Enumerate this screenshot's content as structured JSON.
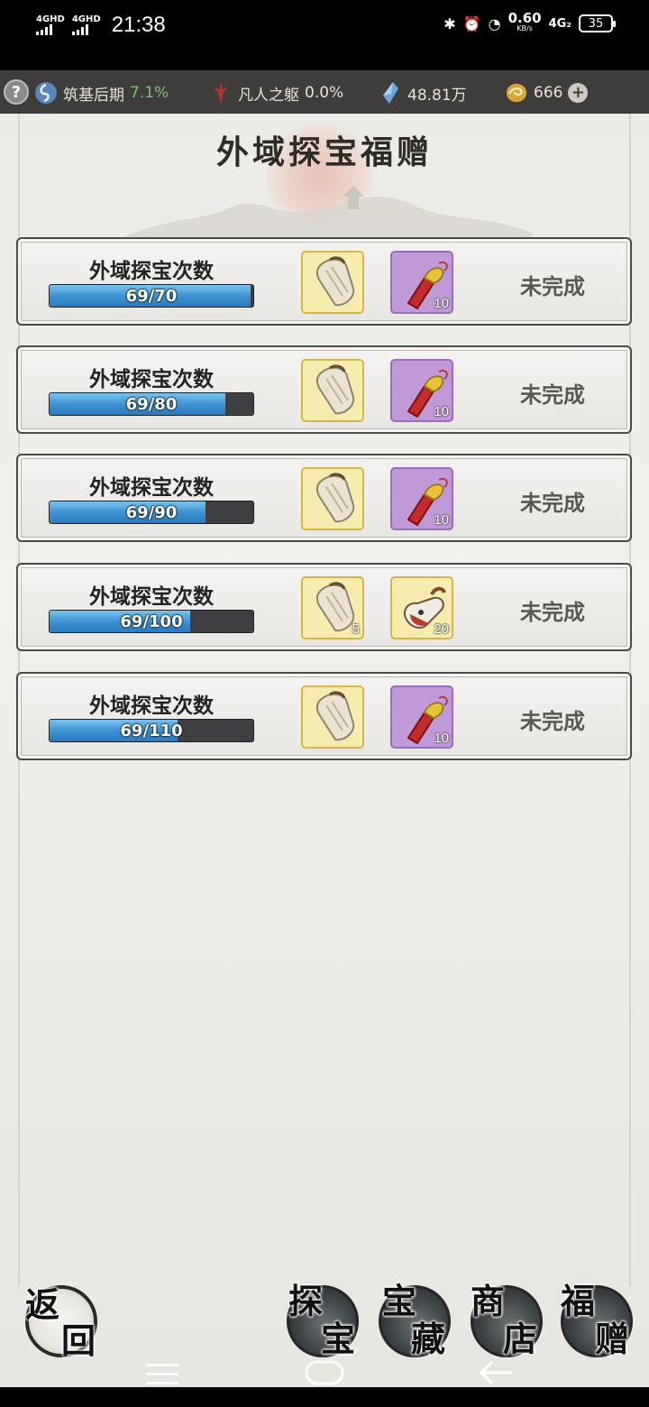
{
  "status_bar": {
    "signal1": "4GHD",
    "signal2": "4GHD",
    "time": "21:38",
    "net_speed": "0.60",
    "net_unit": "KB/s",
    "network": "4G₂",
    "battery": "35"
  },
  "resources": {
    "help_label": "?",
    "cultivation_label": "筑基后期",
    "cultivation_pct": "7.1%",
    "body_label": "凡人之躯",
    "body_pct": "0.0%",
    "crystal_value": "48.81万",
    "coin_value": "666",
    "plus_label": "+"
  },
  "page": {
    "title": "外域探宝福赠"
  },
  "tasks": [
    {
      "title": "外域探宝次数",
      "progress": "69/70",
      "fraction": 0.986,
      "item1_color": "gold",
      "item1_qty": "",
      "item2_color": "purple",
      "item2_qty": "10",
      "item2_icon": "red-scroll-icon",
      "status": "未完成"
    },
    {
      "title": "外域探宝次数",
      "progress": "69/80",
      "fraction": 0.8625,
      "item1_color": "gold",
      "item1_qty": "",
      "item2_color": "purple",
      "item2_qty": "10",
      "item2_icon": "red-scroll-icon",
      "status": "未完成"
    },
    {
      "title": "外域探宝次数",
      "progress": "69/90",
      "fraction": 0.7667,
      "item1_color": "gold",
      "item1_qty": "",
      "item2_color": "purple",
      "item2_qty": "10",
      "item2_icon": "red-scroll-icon",
      "status": "未完成"
    },
    {
      "title": "外域探宝次数",
      "progress": "69/100",
      "fraction": 0.69,
      "item1_color": "gold",
      "item1_qty": "5",
      "item2_color": "gold",
      "item2_qty": "20",
      "item2_icon": "gourd-scroll-icon",
      "status": "未完成"
    },
    {
      "title": "外域探宝次数",
      "progress": "69/110",
      "fraction": 0.627,
      "item1_color": "gold",
      "item1_qty": "",
      "item2_color": "purple",
      "item2_qty": "10",
      "item2_icon": "red-scroll-icon",
      "status": "未完成"
    }
  ],
  "nav": {
    "back_1": "返",
    "back_2": "回",
    "explore_1": "探",
    "explore_2": "宝",
    "treasure_1": "宝",
    "treasure_2": "藏",
    "shop_1": "商",
    "shop_2": "店",
    "gift_1": "福",
    "gift_2": "赠"
  },
  "system_nav": [
    "menu-icon",
    "home-icon",
    "back-arrow-icon"
  ]
}
